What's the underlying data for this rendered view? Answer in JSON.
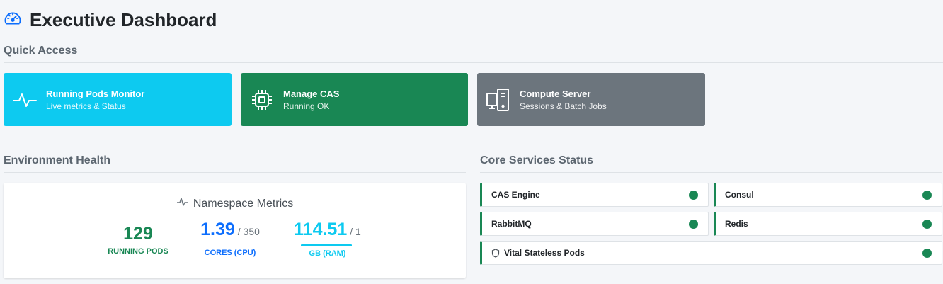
{
  "header": {
    "title": "Executive Dashboard",
    "icon": "speedometer-icon"
  },
  "quick_access": {
    "heading": "Quick Access",
    "tiles": [
      {
        "title": "Running Pods Monitor",
        "subtitle": "Live metrics & Status",
        "color": "#0dcaf0",
        "icon": "activity-icon"
      },
      {
        "title": "Manage CAS",
        "subtitle": "Running OK",
        "color": "#198754",
        "icon": "cpu-icon"
      },
      {
        "title": "Compute Server",
        "subtitle": "Sessions & Batch Jobs",
        "color": "#6c757d",
        "icon": "server-icon"
      }
    ]
  },
  "environment_health": {
    "heading": "Environment Health",
    "card_title": "Namespace Metrics",
    "metrics": [
      {
        "value": "129",
        "suffix": "",
        "label": "RUNNING PODS",
        "color": "#198754"
      },
      {
        "value": "1.39",
        "suffix": "/ 350",
        "label": "CORES (CPU)",
        "color": "#0d6efd"
      },
      {
        "value": "114.51",
        "suffix": "/ 1",
        "label": "GB (RAM)",
        "color": "#0dcaf0"
      }
    ]
  },
  "core_services": {
    "heading": "Core Services Status",
    "services": [
      {
        "name": "CAS Engine",
        "status": "healthy"
      },
      {
        "name": "Consul",
        "status": "healthy"
      },
      {
        "name": "RabbitMQ",
        "status": "healthy"
      },
      {
        "name": "Redis",
        "status": "healthy"
      },
      {
        "name": "Vital Stateless Pods",
        "status": "healthy",
        "icon": "shield-icon"
      }
    ],
    "status_color": "#198754"
  }
}
